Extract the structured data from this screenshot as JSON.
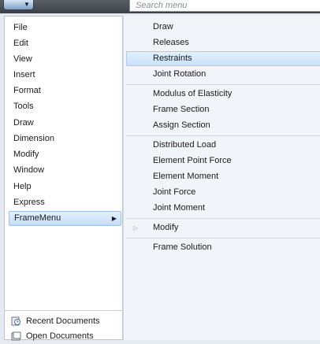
{
  "search": {
    "placeholder": "Search menu"
  },
  "left_menu": {
    "items": [
      {
        "label": "File"
      },
      {
        "label": "Edit"
      },
      {
        "label": "View"
      },
      {
        "label": "Insert"
      },
      {
        "label": "Format"
      },
      {
        "label": "Tools"
      },
      {
        "label": "Draw"
      },
      {
        "label": "Dimension"
      },
      {
        "label": "Modify"
      },
      {
        "label": "Window"
      },
      {
        "label": "Help"
      },
      {
        "label": "Express"
      },
      {
        "label": "FrameMenu",
        "active": true
      }
    ],
    "bottom": [
      {
        "label": "Recent Documents",
        "icon": "recent-documents-icon"
      },
      {
        "label": "Open Documents",
        "icon": "open-documents-icon"
      }
    ]
  },
  "right_menu": {
    "groups": [
      [
        "Draw",
        "Releases",
        "Restraints",
        "Joint Rotation"
      ],
      [
        "Modulus of Elasticity",
        "Frame Section",
        "Assign Section"
      ],
      [
        "Distributed Load",
        "Element Point Force",
        "Element Moment",
        "Joint Force",
        "Joint Moment"
      ],
      [
        "Modify"
      ],
      [
        "Frame Solution"
      ]
    ],
    "highlighted": "Restraints",
    "submenu_item": "Modify"
  },
  "colors": {
    "highlight": "#c9e1f9",
    "highlight_border": "#a9cbef"
  }
}
